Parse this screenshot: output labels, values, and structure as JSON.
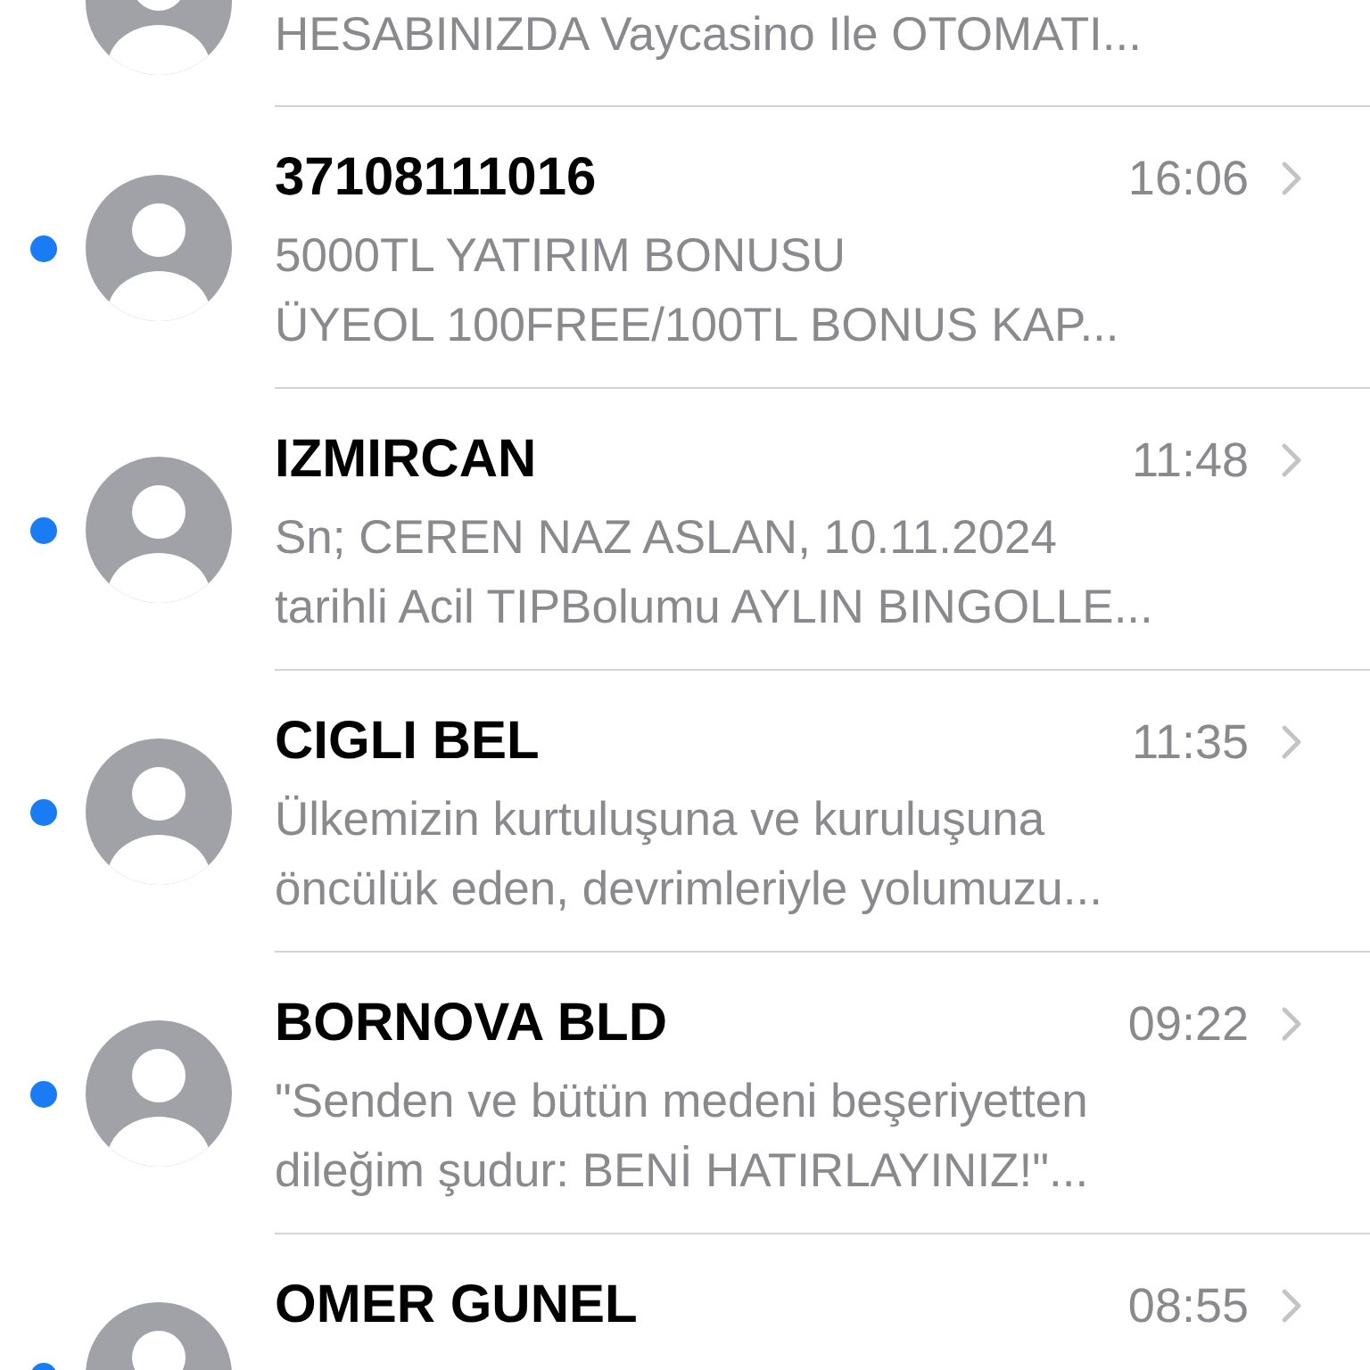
{
  "conversations": [
    {
      "kind": "partial",
      "preview": [
        "HESABINIZDA Vaycasino Ile OTOMATI..."
      ]
    },
    {
      "kind": "full",
      "unread": true,
      "sender": "37108111016",
      "time": "16:06",
      "preview": [
        "5000TL YATIRIM BONUSU",
        "ÜYEOL 100FREE/100TL BONUS KAP..."
      ]
    },
    {
      "kind": "full",
      "unread": true,
      "sender": "IZMIRCAN",
      "time": "11:48",
      "preview": [
        "Sn; CEREN NAZ ASLAN, 10.11.2024",
        "tarihli Acil TIPBolumu AYLIN BINGOLLE..."
      ]
    },
    {
      "kind": "full",
      "unread": true,
      "sender": "CIGLI BEL",
      "time": "11:35",
      "preview": [
        "Ülkemizin kurtuluşuna ve kuruluşuna",
        "öncülük eden, devrimleriyle yolumuzu..."
      ]
    },
    {
      "kind": "full",
      "unread": true,
      "sender": "BORNOVA BLD",
      "time": "09:22",
      "preview": [
        "\"Senden ve bütün medeni beşeriyetten",
        "dileğim şudur: BENİ HATIRLAYINIZ!\"..."
      ]
    },
    {
      "kind": "full",
      "unread": true,
      "sender": "OMER GUNEL",
      "time": "08:55"
    }
  ]
}
